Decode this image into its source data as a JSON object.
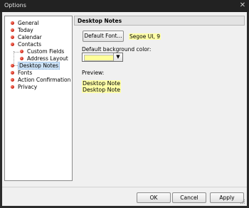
{
  "window": {
    "title": "Options",
    "close_symbol": "✕"
  },
  "sidebar": {
    "items": [
      {
        "label": "General",
        "icon": "red-dot-icon"
      },
      {
        "label": "Today",
        "icon": "red-dot-icon"
      },
      {
        "label": "Calendar",
        "icon": "red-dot-icon"
      },
      {
        "label": "Contacts",
        "icon": "red-dot-icon"
      },
      {
        "label": "Custom Fields",
        "icon": "red-dot-icon"
      },
      {
        "label": "Address Layout",
        "icon": "red-dot-icon"
      },
      {
        "label": "Desktop Notes",
        "icon": "red-dot-icon",
        "selected": true
      },
      {
        "label": "Fonts",
        "icon": "red-dot-icon"
      },
      {
        "label": "Action Confirmation",
        "icon": "red-dot-icon"
      },
      {
        "label": "Privacy",
        "icon": "red-dot-icon"
      }
    ]
  },
  "panel": {
    "header": "Desktop Notes",
    "default_font_button": "Default Font...",
    "font_value": "Segoe UI, 9",
    "background_label": "Default background color:",
    "background_color": "#ffff99",
    "preview_label": "Preview:",
    "preview_lines": [
      "Desktop Note",
      "Desktop Note"
    ]
  },
  "footer": {
    "ok_label": "OK",
    "cancel_label": "Cancel",
    "apply_label": "Apply"
  },
  "colors": {
    "title_bar": "#222222",
    "selection": "#cde3f7",
    "note_highlight": "#ffffa8",
    "bullet": "#c41b0b"
  }
}
